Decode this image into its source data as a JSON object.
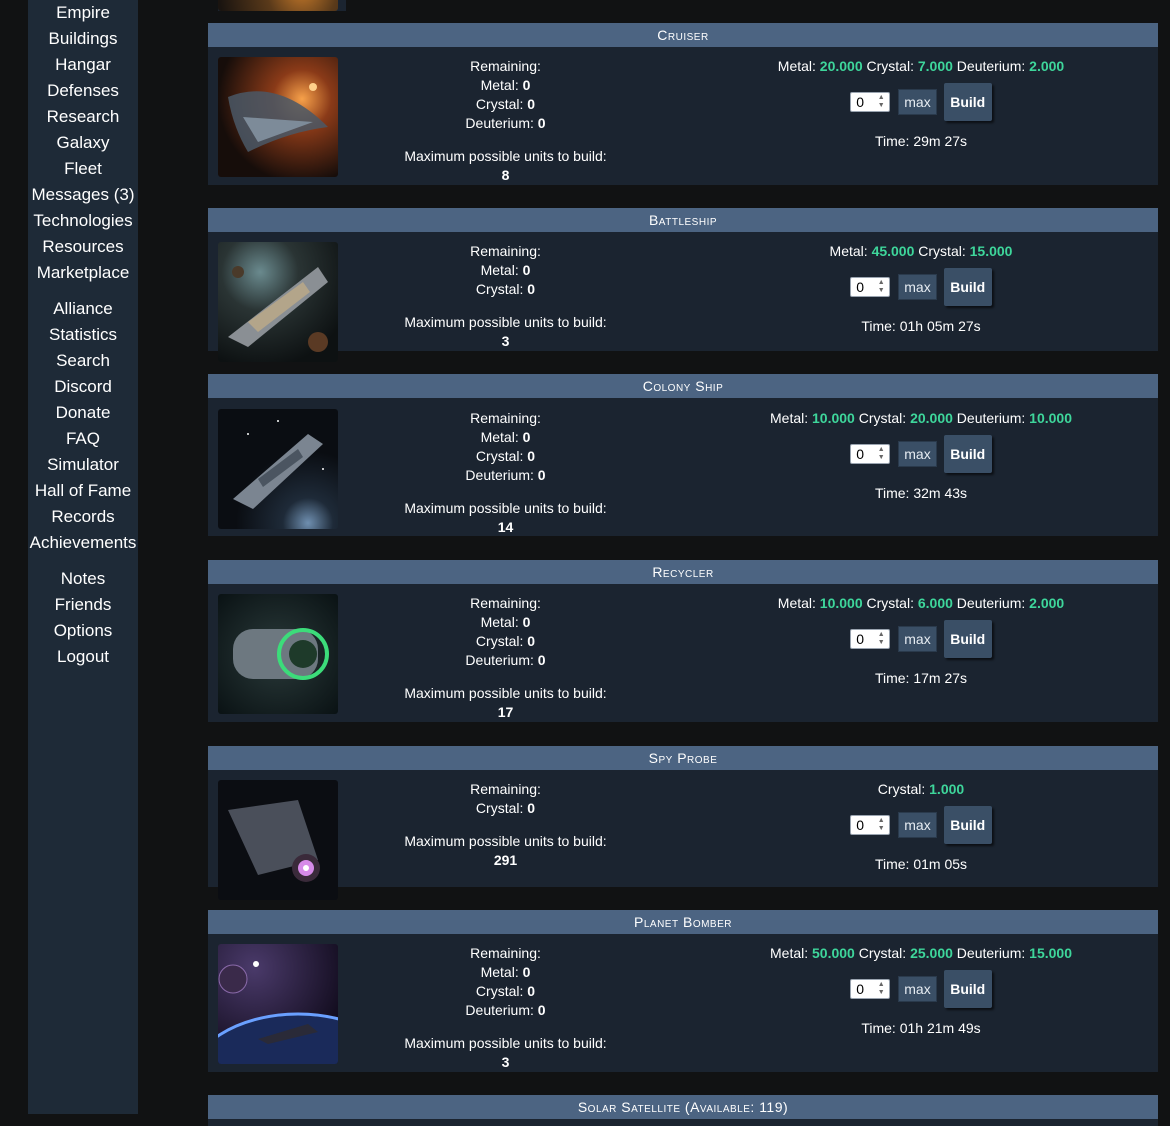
{
  "nav": {
    "group1": [
      "Empire",
      "Buildings",
      "Hangar",
      "Defenses",
      "Research",
      "Galaxy",
      "Fleet",
      "Messages (3)",
      "Technologies",
      "Resources",
      "Marketplace"
    ],
    "group2": [
      "Alliance",
      "Statistics",
      "Search",
      "Discord",
      "Donate",
      "FAQ",
      "Simulator",
      "Hall of Fame",
      "Records",
      "Achievements"
    ],
    "group3": [
      "Notes",
      "Friends",
      "Options",
      "Logout"
    ]
  },
  "labels": {
    "remaining": "Remaining:",
    "max_possible": "Maximum possible units to build:",
    "metal": "Metal:",
    "crystal": "Crystal:",
    "deuterium": "Deuterium:",
    "max_button": "max",
    "build_button": "Build",
    "time_prefix": "Time:"
  },
  "colors": {
    "accent_green": "#3ed69b",
    "header_bg": "#4c6482",
    "panel_bg": "#1b2430"
  },
  "units": [
    {
      "name": "Cruiser",
      "image_icon": "cruiser-image",
      "remaining": {
        "metal": "0",
        "crystal": "0",
        "deuterium": "0"
      },
      "max_units": "8",
      "cost": {
        "metal": "20.000",
        "crystal": "7.000",
        "deuterium": "2.000"
      },
      "quantity": "0",
      "time": "29m 27s"
    },
    {
      "name": "Battleship",
      "image_icon": "battleship-image",
      "remaining": {
        "metal": "0",
        "crystal": "0"
      },
      "max_units": "3",
      "cost": {
        "metal": "45.000",
        "crystal": "15.000"
      },
      "quantity": "0",
      "time": "01h 05m 27s"
    },
    {
      "name": "Colony Ship",
      "image_icon": "colony-ship-image",
      "remaining": {
        "metal": "0",
        "crystal": "0",
        "deuterium": "0"
      },
      "max_units": "14",
      "cost": {
        "metal": "10.000",
        "crystal": "20.000",
        "deuterium": "10.000"
      },
      "quantity": "0",
      "time": "32m 43s"
    },
    {
      "name": "Recycler",
      "image_icon": "recycler-image",
      "remaining": {
        "metal": "0",
        "crystal": "0",
        "deuterium": "0"
      },
      "max_units": "17",
      "cost": {
        "metal": "10.000",
        "crystal": "6.000",
        "deuterium": "2.000"
      },
      "quantity": "0",
      "time": "17m 27s"
    },
    {
      "name": "Spy Probe",
      "image_icon": "spy-probe-image",
      "remaining": {
        "crystal": "0"
      },
      "max_units": "291",
      "cost": {
        "crystal": "1.000"
      },
      "quantity": "0",
      "time": "01m 05s"
    },
    {
      "name": "Planet Bomber",
      "image_icon": "planet-bomber-image",
      "remaining": {
        "metal": "0",
        "crystal": "0",
        "deuterium": "0"
      },
      "max_units": "3",
      "cost": {
        "metal": "50.000",
        "crystal": "25.000",
        "deuterium": "15.000"
      },
      "quantity": "0",
      "time": "01h 21m 49s"
    }
  ],
  "next_unit": {
    "name": "Solar Satellite (Available: 119)"
  }
}
